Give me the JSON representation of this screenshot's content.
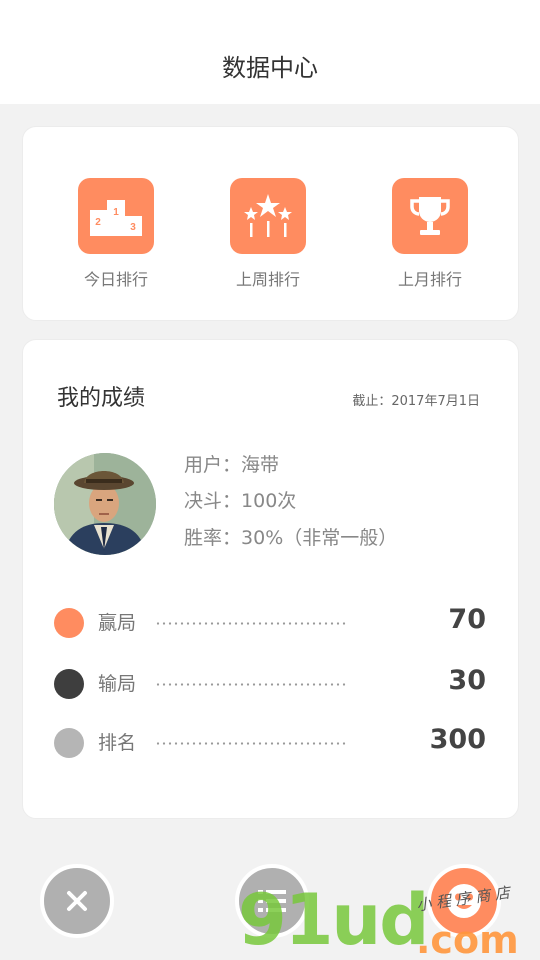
{
  "header": {
    "title": "数据中心"
  },
  "rankings": [
    {
      "label": "今日排行",
      "icon": "podium-icon"
    },
    {
      "label": "上周排行",
      "icon": "stars-icon"
    },
    {
      "label": "上月排行",
      "icon": "trophy-icon"
    }
  ],
  "score": {
    "title": "我的成绩",
    "date": "截止：2017年7月1日",
    "user_key": "用户：",
    "user_value": "海带",
    "duel_key": "决斗：",
    "duel_value": "100次",
    "win_key": "胜率：",
    "win_value": "30%（非常一般）",
    "stats": [
      {
        "name": "赢局",
        "value": "70",
        "color": "#ff8c60"
      },
      {
        "name": "输局",
        "value": "30",
        "color": "#3e3e3e"
      },
      {
        "name": "排名",
        "value": "300",
        "color": "#b5b5b5"
      }
    ]
  },
  "fabs": {
    "close_color": "#b0b0b0",
    "list_color": "#b0b0b0",
    "face_color": "#ff8c60"
  },
  "watermark": {
    "main": "91ud",
    "suffix": ".com",
    "sub": "小 程 序 商 店"
  }
}
